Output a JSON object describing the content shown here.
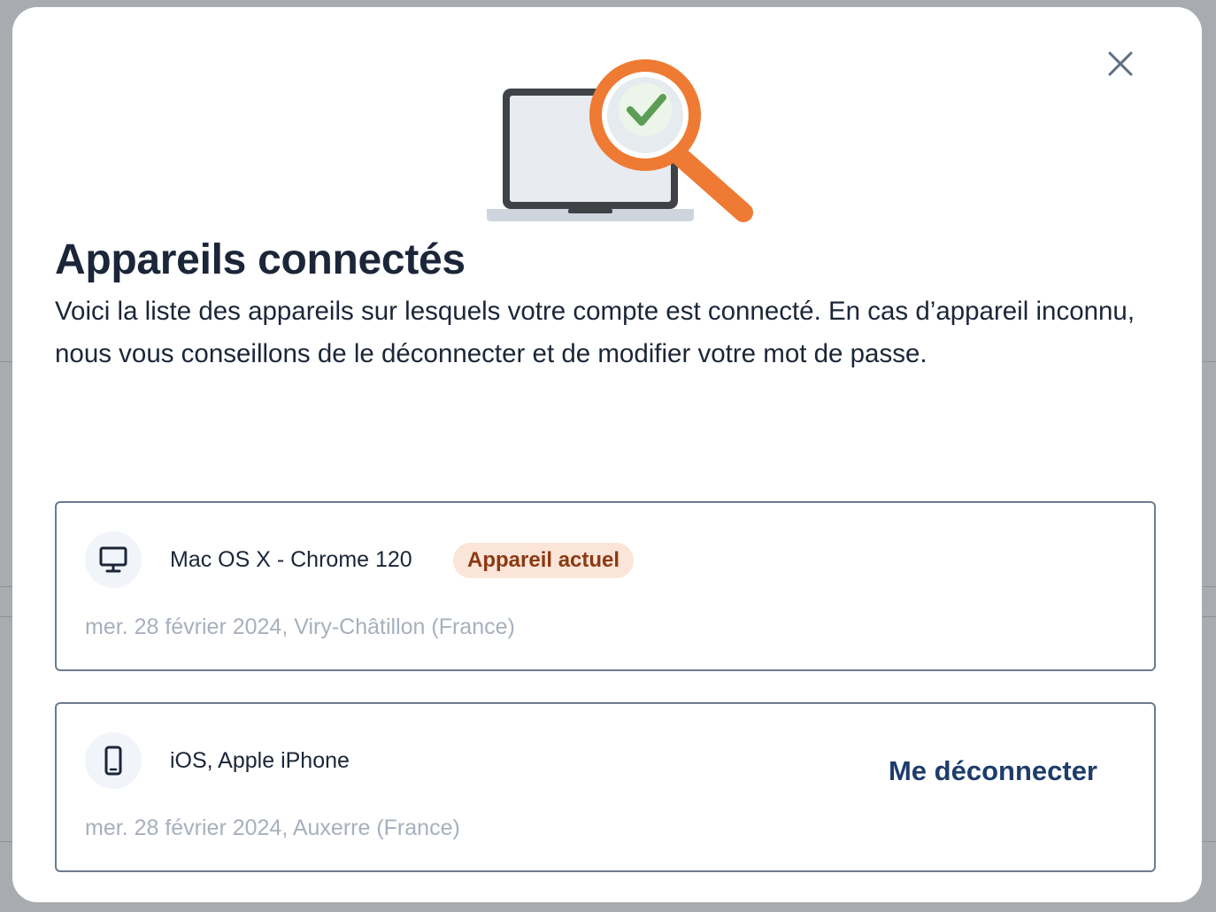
{
  "modal": {
    "title": "Appareils connectés",
    "description": "Voici la liste des appareils sur lesquels votre compte est connecté. En cas d’appareil inconnu, nous vous conseillons de le déconnecter et de modifier votre mot de passe.",
    "close_icon": "close-icon",
    "illustration": "laptop-magnifier-check-illustration"
  },
  "devices": [
    {
      "icon": "desktop-icon",
      "name": "Mac OS X - Chrome 120",
      "badge": "Appareil actuel",
      "meta": "mer. 28 février 2024, Viry-Châtillon (France)"
    },
    {
      "icon": "smartphone-icon",
      "name": "iOS, Apple iPhone",
      "action_label": "Me déconnecter",
      "meta": "mer. 28 février 2024, Auxerre (France)"
    }
  ],
  "colors": {
    "accent_orange": "#ee7a33",
    "check_green": "#5c9c55",
    "title_navy": "#1b2638",
    "link_navy": "#1d3d6b",
    "badge_bg": "#fbe4d8",
    "badge_text": "#8a3a12"
  }
}
